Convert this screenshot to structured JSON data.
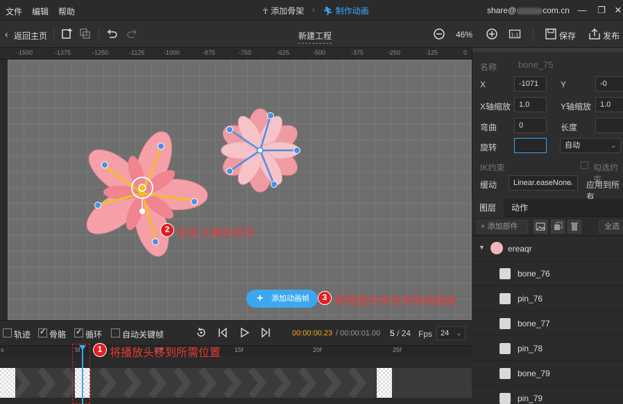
{
  "menubar": {
    "items": [
      "文件",
      "编辑",
      "帮助"
    ],
    "steps": [
      {
        "label": "添加骨架"
      },
      {
        "label": "制作动画"
      }
    ],
    "account": {
      "prefix": "share@",
      "suffix": "com.cn"
    }
  },
  "toolbar": {
    "back_label": "返回主页",
    "project_title": "新建工程",
    "zoom": "46%",
    "save_label": "保存",
    "publish_label": "发布"
  },
  "ruler_top_labels": [
    "-1500",
    "-1375",
    "-1250",
    "-1125",
    "-1000",
    "-875",
    "-750",
    "-625",
    "-500",
    "-375",
    "-250",
    "-125",
    "0"
  ],
  "annotations": {
    "a1": {
      "num": "1",
      "text": "将播放头移到所需位置"
    },
    "a2": {
      "num": "2",
      "text": "自定义角色动作"
    },
    "a3": {
      "num": "3",
      "text": "再将图片状态添加动画帧"
    }
  },
  "add_frame_button": "添加动画帧",
  "props": {
    "name_label": "名称",
    "name_value": "bone_75",
    "x_label": "X",
    "x_value": "-1071",
    "y_label": "Y",
    "y_value": "-0",
    "sx_label": "X轴缩放",
    "sx_value": "1.0",
    "sy_label": "Y轴缩放",
    "sy_value": "1.0",
    "bend_label": "弯曲",
    "bend_value": "0",
    "length_label": "长度",
    "length_value": "",
    "rotate_label": "旋转",
    "rotate_value": "",
    "auto_label": "自动",
    "ik_label": "IK约束",
    "ik_check_label": "勾选约束",
    "ease_label": "缓动",
    "ease_value": "Linear.easeNone",
    "apply_all_label": "应用到所有"
  },
  "tabs": [
    {
      "label": "图层"
    },
    {
      "label": "动作"
    }
  ],
  "layer_tools": {
    "add_part_label": "添加部件",
    "select_all_label": "全选"
  },
  "layers": {
    "group_name": "ereaqr",
    "rows": [
      "bone_76",
      "pin_76",
      "bone_77",
      "pin_78",
      "bone_79",
      "pin_79"
    ]
  },
  "timeline": {
    "track_label": "轨迹",
    "bone_label": "骨骼",
    "loop_label": "循环",
    "autokey_label": "自动关键帧",
    "time_current": "00:00:00.23",
    "time_total": "/ 00:00:01.00",
    "frame_current": "5",
    "frame_total": "/ 24",
    "fps_label": "Fps",
    "fps_value": "24",
    "tick_labels": [
      "s",
      "5f",
      "10f",
      "15f",
      "20f",
      "25f"
    ]
  },
  "colors": {
    "accent": "#3aa7f0",
    "annotation_red": "#e02020",
    "petal": "#f5a0a8",
    "bone_yellow": "#f2c022",
    "bone_blue": "#4a90e2"
  }
}
